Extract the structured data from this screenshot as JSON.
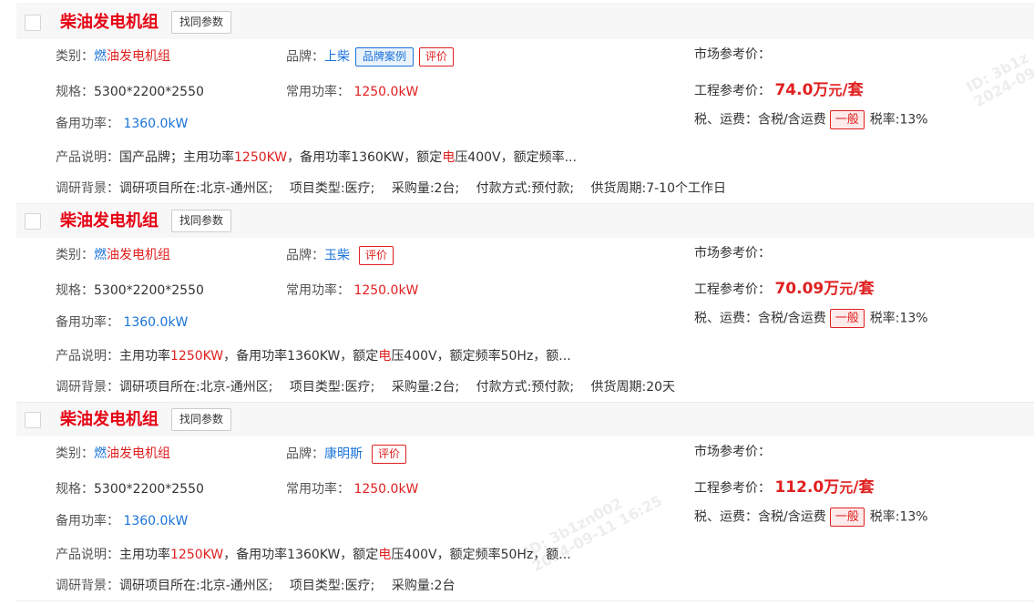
{
  "labels": {
    "find_same": "找同参数",
    "category": "类别：",
    "brand": "品牌：",
    "spec": "规格：",
    "common_power": "常用功率：",
    "standby_power": "备用功率：",
    "desc": "产品说明：",
    "background": "调研背景：",
    "market_price": "市场参考价：",
    "eng_price": "工程参考价：",
    "tax": "税、运费：",
    "brand_case": "品牌案例",
    "review": "评价",
    "general": "一般"
  },
  "watermarks": [
    {
      "id": "ID: 3b1zn002",
      "time": "2024-09-11 16:25"
    },
    {
      "id": "ID: 3b1z",
      "time": "2024-09"
    }
  ],
  "products": [
    {
      "title": "柴油发电机组",
      "category": {
        "pre": "燃",
        "rest": "油发电机组"
      },
      "brand": "上柴",
      "has_case": true,
      "spec": "5300*2200*2550",
      "common_power": "1250.0kW",
      "standby_power": "1360.0kW",
      "desc": {
        "p1": "国产品牌；主用功率",
        "p2": "1250KW",
        "p3": "，备用功率1360KW，额定",
        "p4": "电",
        "p5": "压400V，额定频率..."
      },
      "background": "调研项目所在:北京-通州区;　 项目类型:医疗;　 采购量:2台;　 付款方式:预付款;　 供货周期:7-10个工作日",
      "market_price": "",
      "price_num": "74.0",
      "price_wan": "万",
      "price_yuan": "元",
      "price_unit": "/套",
      "tax_value": "含税/含运费",
      "tax_rate": "税率:13%"
    },
    {
      "title": "柴油发电机组",
      "category": {
        "pre": "燃",
        "rest": "油发电机组"
      },
      "brand": "玉柴",
      "has_case": false,
      "spec": "5300*2200*2550",
      "common_power": "1250.0kW",
      "standby_power": "1360.0kW",
      "desc": {
        "p1": "主用功率",
        "p2": "1250KW",
        "p3": "，备用功率1360KW，额定",
        "p4": "电",
        "p5": "压400V，额定频率50Hz，额..."
      },
      "background": "调研项目所在:北京-通州区;　 项目类型:医疗;　 采购量:2台;　 付款方式:预付款;　 供货周期:20天",
      "market_price": "",
      "price_num": "70.09",
      "price_wan": "万",
      "price_yuan": "元",
      "price_unit": "/套",
      "tax_value": "含税/含运费",
      "tax_rate": "税率:13%"
    },
    {
      "title": "柴油发电机组",
      "category": {
        "pre": "燃",
        "rest": "油发电机组"
      },
      "brand": "康明斯",
      "has_case": false,
      "spec": "5300*2200*2550",
      "common_power": "1250.0kW",
      "standby_power": "1360.0kW",
      "desc": {
        "p1": "主用功率",
        "p2": "1250KW",
        "p3": "，备用功率1360KW，额定",
        "p4": "电",
        "p5": "压400V，额定频率50Hz，额..."
      },
      "background": "调研项目所在:北京-通州区;　 项目类型:医疗;　 采购量:2台",
      "market_price": "",
      "price_num": "112.0",
      "price_wan": "万",
      "price_yuan": "元",
      "price_unit": "/套",
      "tax_value": "含税/含运费",
      "tax_rate": "税率:13%"
    }
  ]
}
